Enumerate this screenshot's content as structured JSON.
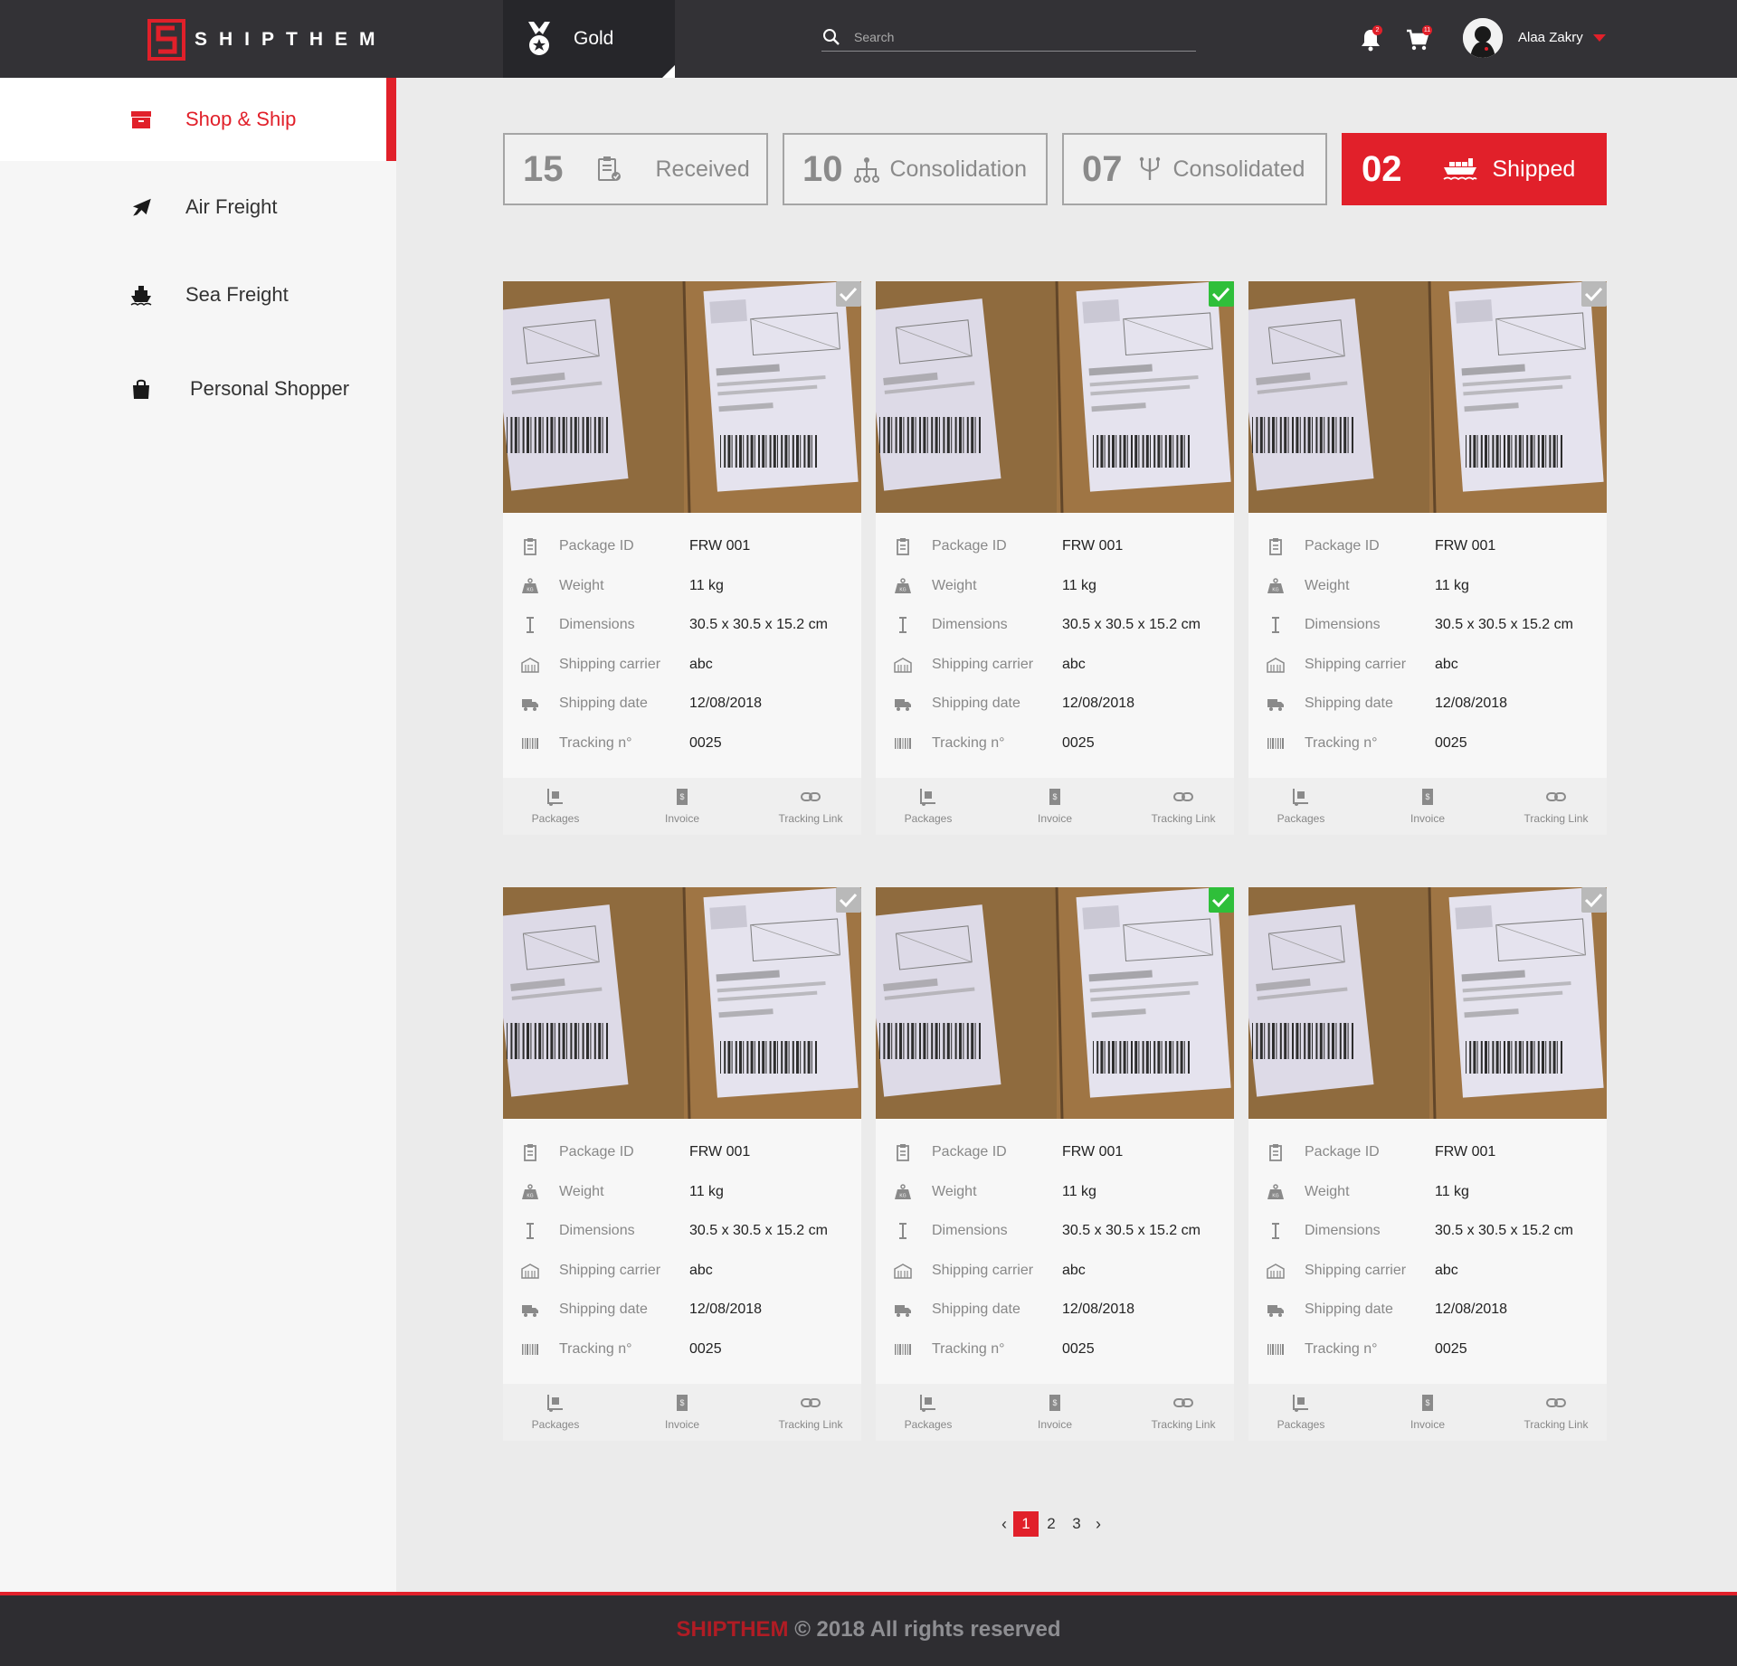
{
  "brand": {
    "name": "SHIPTHEM",
    "accent": "#e1202a"
  },
  "header": {
    "tier": {
      "label": "Gold",
      "icon": "medal-icon"
    },
    "search": {
      "placeholder": "Search"
    },
    "notifications": {
      "icon": "bell-icon",
      "badge": "2"
    },
    "cart": {
      "icon": "cart-icon",
      "badge": "11"
    },
    "user": {
      "name": "Alaa Zakry",
      "icon": "chevron-down-icon"
    }
  },
  "sidebar": {
    "items": [
      {
        "label": "Shop & Ship",
        "icon": "box-icon",
        "active": true
      },
      {
        "label": "Air Freight",
        "icon": "airplane-icon",
        "active": false
      },
      {
        "label": "Sea Freight",
        "icon": "ship-icon",
        "active": false
      },
      {
        "label": "Personal Shopper",
        "icon": "shopping-bag-icon",
        "active": false
      }
    ]
  },
  "tabs": [
    {
      "count": "15",
      "label": "Received",
      "icon": "clipboard-check-icon",
      "active": false
    },
    {
      "count": "10",
      "label": "Consolidation",
      "icon": "hierarchy-icon",
      "active": false
    },
    {
      "count": "07",
      "label": "Consolidated",
      "icon": "merge-icon",
      "active": false
    },
    {
      "count": "02",
      "label": "Shipped",
      "icon": "cargo-ship-icon",
      "active": true
    }
  ],
  "card_fields": {
    "package_id": "Package ID",
    "weight": "Weight",
    "dimensions": "Dimensions",
    "carrier": "Shipping carrier",
    "date": "Shipping date",
    "tracking": "Tracking n°"
  },
  "card_actions": {
    "packages": "Packages",
    "invoice": "Invoice",
    "tracking_link": "Tracking Link"
  },
  "packages": [
    {
      "selected": false,
      "package_id": "FRW 001",
      "weight": "11 kg",
      "dimensions": "30.5 x 30.5 x 15.2 cm",
      "carrier": "abc",
      "date": "12/08/2018",
      "tracking": "0025"
    },
    {
      "selected": true,
      "package_id": "FRW 001",
      "weight": "11 kg",
      "dimensions": "30.5 x 30.5 x 15.2 cm",
      "carrier": "abc",
      "date": "12/08/2018",
      "tracking": "0025"
    },
    {
      "selected": false,
      "package_id": "FRW 001",
      "weight": "11 kg",
      "dimensions": "30.5 x 30.5 x 15.2 cm",
      "carrier": "abc",
      "date": "12/08/2018",
      "tracking": "0025"
    },
    {
      "selected": false,
      "package_id": "FRW 001",
      "weight": "11 kg",
      "dimensions": "30.5 x 30.5 x 15.2 cm",
      "carrier": "abc",
      "date": "12/08/2018",
      "tracking": "0025"
    },
    {
      "selected": true,
      "package_id": "FRW 001",
      "weight": "11 kg",
      "dimensions": "30.5 x 30.5 x 15.2 cm",
      "carrier": "abc",
      "date": "12/08/2018",
      "tracking": "0025"
    },
    {
      "selected": false,
      "package_id": "FRW 001",
      "weight": "11 kg",
      "dimensions": "30.5 x 30.5 x 15.2 cm",
      "carrier": "abc",
      "date": "12/08/2018",
      "tracking": "0025"
    }
  ],
  "pagination": {
    "pages": [
      "1",
      "2",
      "3"
    ],
    "current": "1",
    "prev": "‹",
    "next": "›"
  },
  "footer": {
    "brand": "SHIPTHEM",
    "text": "© 2018 All rights reserved"
  }
}
